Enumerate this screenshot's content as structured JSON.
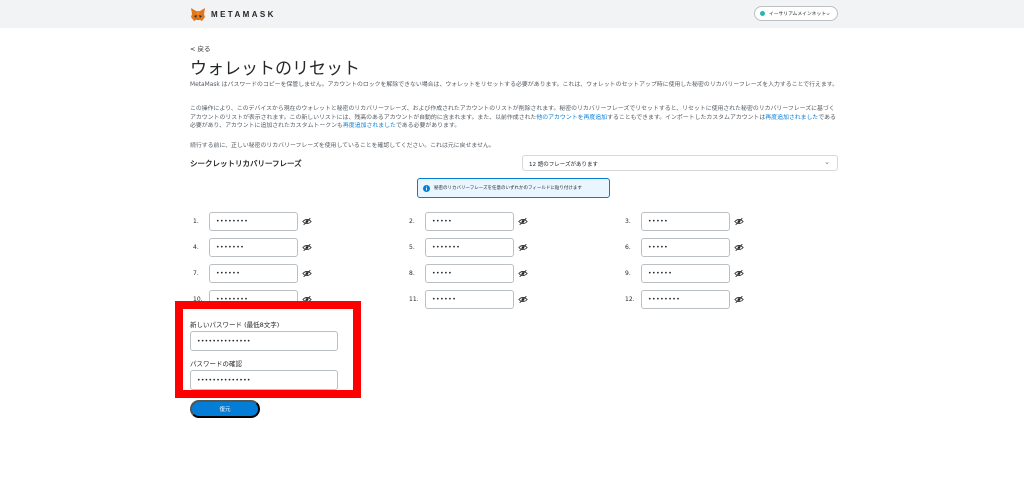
{
  "header": {
    "brand": "METAMASK",
    "network": "イーサリアムメインネット"
  },
  "page": {
    "back": "< 戻る",
    "title": "ウォレットのリセット",
    "intro": "MetaMask はパスワードのコピーを保管しません。アカウントのロックを解除できない場合は、ウォレットをリセットする必要があります。これは、ウォレットのセットアップ時に使用した秘密のリカバリーフレーズを入力することで行えます。",
    "warning_parts": [
      "この操作により、このデバイスから現在のウォレットと秘密のリカバリーフレーズ、および作成されたアカウントのリストが削除されます。秘密のリカバリーフレーズでリセットすると、リセットに使用された秘密のリカバリーフレーズに基づくアカウントのリストが表示されます。この新しいリストには、残高のあるアカウントが自動的に含まれます。また、以前作成された",
      "他のアカウントを再度追加",
      "することもできます。インポートしたカスタムアカウントは",
      "再度追加されました",
      "である必要があり、アカウントに追加されたカスタムトークンも",
      "再度追加されました",
      "である必要があります。"
    ],
    "confirm_note": "続行する前に、正しい秘密のリカバリーフレーズを使用していることを確認してください。これは元に戻せません。"
  },
  "srp": {
    "label": "シークレットリカバリーフレーズ",
    "select_value": "12 語のフレーズがあります",
    "paste_hint": "秘密のリカバリーフレーズを任意のいずれかのフィールドに貼り付けます",
    "words": [
      {
        "num": "1.",
        "mask": "••••••••"
      },
      {
        "num": "2.",
        "mask": "•••••"
      },
      {
        "num": "3.",
        "mask": "•••••"
      },
      {
        "num": "4.",
        "mask": "•••••••"
      },
      {
        "num": "5.",
        "mask": "•••••••"
      },
      {
        "num": "6.",
        "mask": "•••••"
      },
      {
        "num": "7.",
        "mask": "••••••"
      },
      {
        "num": "8.",
        "mask": "•••••"
      },
      {
        "num": "9.",
        "mask": "••••••"
      },
      {
        "num": "10.",
        "mask": "••••••••"
      },
      {
        "num": "11.",
        "mask": "••••••"
      },
      {
        "num": "12.",
        "mask": "••••••••"
      }
    ]
  },
  "password": {
    "new_label": "新しいパスワード (最低8文字)",
    "new_value": "••••••••••••••",
    "confirm_label": "パスワードの確認",
    "confirm_value": "••••••••••••••"
  },
  "actions": {
    "restore": "復元"
  },
  "colors": {
    "accent": "#037dd6",
    "highlight": "#ff0000",
    "network_dot": "#29b6af"
  },
  "icons": {
    "logo": "metamask-fox-icon",
    "word_toggle": "eye-slash-icon",
    "banner": "info-icon",
    "dropdown": "chevron-down-icon"
  }
}
